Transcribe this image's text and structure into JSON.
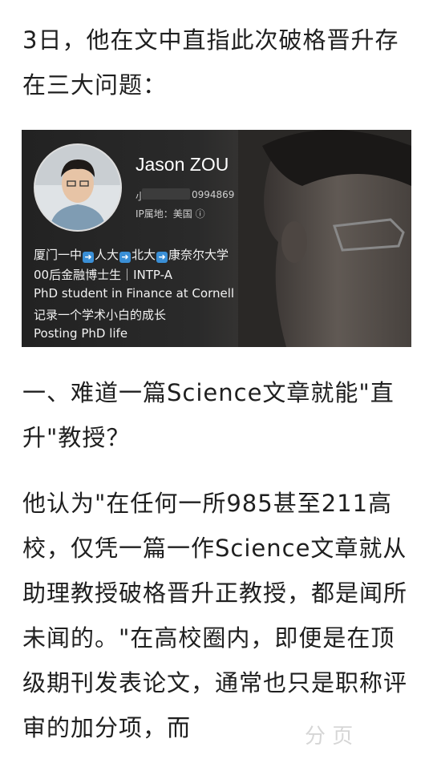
{
  "article": {
    "intro": "3日，他在文中直指此次破格晋升存在三大问题：",
    "question1": "一、难道一篇Science文章就能\"直升\"教授？",
    "body": "他认为\"在任何一所985甚至211高校，仅凭一篇一作Science文章就从助理教授破格晋升正教授，都是闻所未闻的。\"在高校圈内，即便是在顶级期刊发表论文，通常也只是职称评审的加分项，而"
  },
  "profile_card": {
    "name": "Jason ZOU",
    "phone_visible_prefix": "小",
    "phone_visible_suffix": "0994869",
    "ip_location": "IP属地：美国 ⓘ",
    "edu_parts": [
      "厦门一中",
      "人大",
      "北大",
      "康奈尔大学"
    ],
    "line2": "00后金融博士生｜INTP-A",
    "line3": "PhD student in Finance at Cornell",
    "line4": "记录一个学术小白的成长",
    "line5": "Posting PhD life"
  },
  "watermark": "分 页",
  "colors": {
    "text": "#1f1f1f",
    "card_bg": "#242424",
    "arrow": "#3a8fd6"
  }
}
